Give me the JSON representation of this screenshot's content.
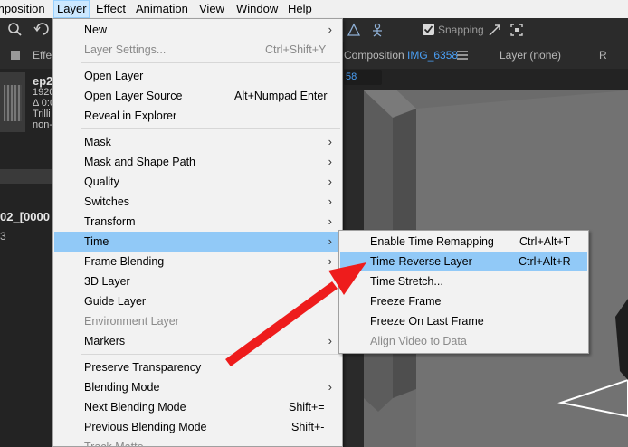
{
  "menubar": [
    {
      "label": "mposition"
    },
    {
      "label": "Layer",
      "active": true
    },
    {
      "label": "Effect"
    },
    {
      "label": "Animation"
    },
    {
      "label": "View"
    },
    {
      "label": "Window"
    },
    {
      "label": "Help"
    }
  ],
  "toolbar": {
    "snapping_label": "Snapping",
    "snapping_checked": true
  },
  "panels": {
    "effects_tab": "Effec",
    "comp_tab_prefix": "Composition",
    "comp_tab_name": "IMG_6358",
    "layer_tab": "Layer (none)",
    "right_tab": "R",
    "comp_tab_short": "58"
  },
  "project": {
    "title": "ep2",
    "line1": "1920",
    "line2": "Δ 0:0",
    "line3": "Trilli",
    "line4": "non-"
  },
  "timeline": {
    "comp_name": "02_[0000",
    "num": "3"
  },
  "layer_menu": [
    {
      "label": "New",
      "arrow": true
    },
    {
      "label": "Layer Settings...",
      "shortcut": "Ctrl+Shift+Y",
      "disabled": true
    },
    {
      "sep": true
    },
    {
      "label": "Open Layer"
    },
    {
      "label": "Open Layer Source",
      "shortcut": "Alt+Numpad Enter"
    },
    {
      "label": "Reveal in Explorer"
    },
    {
      "sep": true
    },
    {
      "label": "Mask",
      "arrow": true
    },
    {
      "label": "Mask and Shape Path",
      "arrow": true
    },
    {
      "label": "Quality",
      "arrow": true
    },
    {
      "label": "Switches",
      "arrow": true
    },
    {
      "label": "Transform",
      "arrow": true
    },
    {
      "label": "Time",
      "arrow": true,
      "highlighted": true
    },
    {
      "label": "Frame Blending",
      "arrow": true
    },
    {
      "label": "3D Layer"
    },
    {
      "label": "Guide Layer"
    },
    {
      "label": "Environment Layer",
      "disabled": true
    },
    {
      "label": "Markers",
      "arrow": true
    },
    {
      "sep": true
    },
    {
      "label": "Preserve Transparency"
    },
    {
      "label": "Blending Mode",
      "arrow": true
    },
    {
      "label": "Next Blending Mode",
      "shortcut": "Shift+="
    },
    {
      "label": "Previous Blending Mode",
      "shortcut": "Shift+-"
    },
    {
      "label": "Track Matte",
      "disabled": true
    }
  ],
  "time_submenu": [
    {
      "label": "Enable Time Remapping",
      "shortcut": "Ctrl+Alt+T"
    },
    {
      "label": "Time-Reverse Layer",
      "shortcut": "Ctrl+Alt+R",
      "highlighted": true
    },
    {
      "label": "Time Stretch..."
    },
    {
      "label": "Freeze Frame"
    },
    {
      "label": "Freeze On Last Frame"
    },
    {
      "label": "Align Video to Data",
      "disabled": true
    }
  ],
  "colors": {
    "highlight": "#91c9f7",
    "arrow": "#ee1c1c",
    "app_bg": "#232323",
    "comp_link": "#4a9ff5"
  },
  "icons": [
    "search-icon",
    "undo-icon",
    "checkbox-icon",
    "snap-icon",
    "fit-icon",
    "hamburger-icon",
    "submenu-arrow-icon"
  ]
}
